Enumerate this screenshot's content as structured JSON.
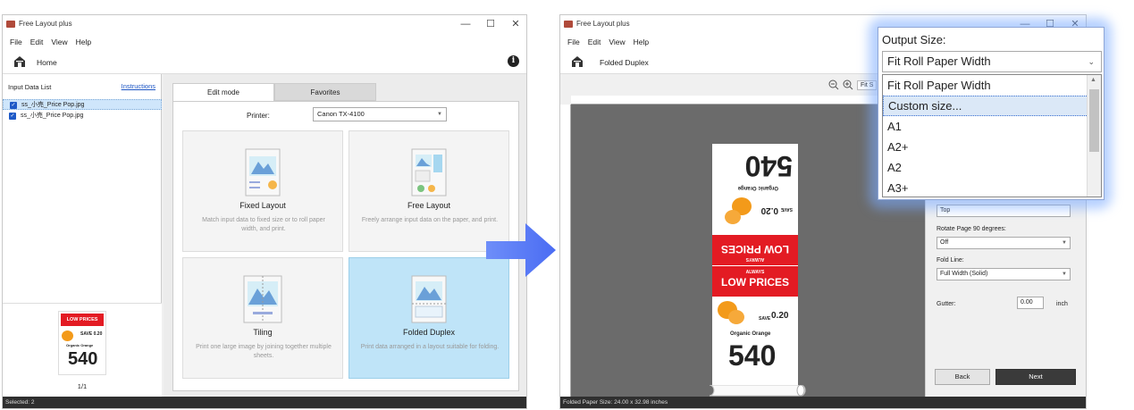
{
  "left_window": {
    "title": "Free Layout plus",
    "controls": [
      "—",
      "☐",
      "✕"
    ],
    "menu": [
      "File",
      "Edit",
      "View",
      "Help"
    ],
    "home_label": "Home",
    "input_list_title": "Input Data List",
    "instructions_link": "Instructions",
    "files": [
      "ss_小売_Price Pop.jpg",
      "ss_小売_Price Pop.jpg"
    ],
    "preview": {
      "band": "LOW PRICES",
      "save": "SAVE 0.20",
      "product": "Organic Orange",
      "price": "540"
    },
    "page_count": "1/1",
    "tabs": [
      "Edit mode",
      "Favorites"
    ],
    "printer_label": "Printer:",
    "printer_value": "Canon TX-4100",
    "cards": [
      {
        "title": "Fixed Layout",
        "desc": "Match input data to fixed size or to roll paper width, and print."
      },
      {
        "title": "Free Layout",
        "desc": "Freely arrange input data on the paper, and print."
      },
      {
        "title": "Tiling",
        "desc": "Print one large image by joining together multiple sheets."
      },
      {
        "title": "Folded Duplex",
        "desc": "Print data arranged in a layout suitable for folding."
      }
    ],
    "status": "Selected: 2"
  },
  "right_window": {
    "title": "Free Layout plus",
    "controls": [
      "—",
      "☐",
      "✕"
    ],
    "menu": [
      "File",
      "Edit",
      "View",
      "Help"
    ],
    "home_label": "Folded Duplex",
    "fit_label": "Fit S",
    "paper": {
      "price_big": "540",
      "organic": "Organic Orange",
      "save_label": "SAVE",
      "save_value": "0.20",
      "always": "ALWAYS",
      "low_prices": "LOW PRICES"
    },
    "settings": {
      "top_value": "Top",
      "rotate_label": "Rotate Page 90 degrees:",
      "rotate_value": "Off",
      "fold_label": "Fold Line:",
      "fold_value": "Full Width (Solid)",
      "gutter_label": "Gutter:",
      "gutter_value": "0.00",
      "gutter_unit": "inch"
    },
    "back_label": "Back",
    "next_label": "Next",
    "status": "Folded Paper Size: 24.00 x 32.98 inches"
  },
  "dropdown": {
    "label": "Output Size:",
    "selected": "Fit Roll Paper Width",
    "options": [
      "Fit Roll Paper Width",
      "Custom size...",
      "A1",
      "A2+",
      "A2",
      "A3+"
    ],
    "highlighted_index": 1
  },
  "colors": {
    "accent_blue": "#5b7cf7",
    "selected_card": "#bfe4f8",
    "price_red": "#e31b23",
    "orange": "#f39a1a"
  }
}
